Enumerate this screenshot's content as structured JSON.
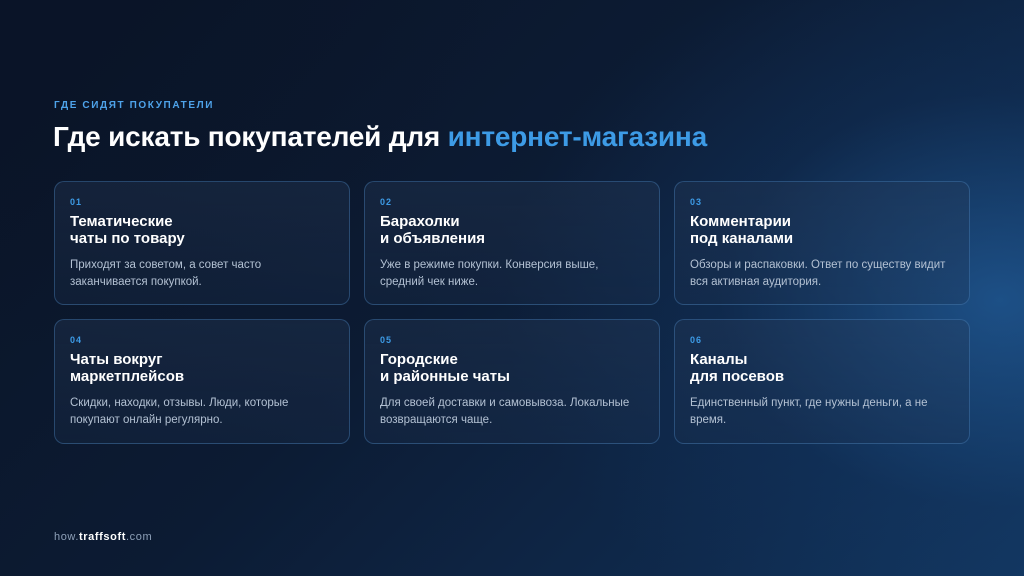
{
  "eyebrow": "ГДЕ СИДЯТ ПОКУПАТЕЛИ",
  "title": {
    "main": "Где искать покупателей для ",
    "accent": "интернет-магазина"
  },
  "accent_color": "#3d9be6",
  "cards": [
    {
      "num": "01",
      "title": "Тематические\nчаты по товару",
      "desc": "Приходят за советом, а совет часто заканчивается покупкой."
    },
    {
      "num": "02",
      "title": "Барахолки\nи объявления",
      "desc": "Уже в режиме покупки. Конверсия выше, средний чек ниже."
    },
    {
      "num": "03",
      "title": "Комментарии\nпод каналами",
      "desc": "Обзоры и распаковки. Ответ по существу видит вся активная аудитория."
    },
    {
      "num": "04",
      "title": "Чаты вокруг\nмаркетплейсов",
      "desc": "Скидки, находки, отзывы. Люди, которые покупают онлайн регулярно."
    },
    {
      "num": "05",
      "title": "Городские\nи районные чаты",
      "desc": "Для своей доставки и самовывоза. Локальные возвращаются чаще."
    },
    {
      "num": "06",
      "title": "Каналы\nдля посевов",
      "desc": "Единственный пункт, где нужны деньги, а не время."
    }
  ],
  "footer": {
    "prefix": "how.",
    "brand": "traffsoft",
    "suffix": ".com"
  }
}
